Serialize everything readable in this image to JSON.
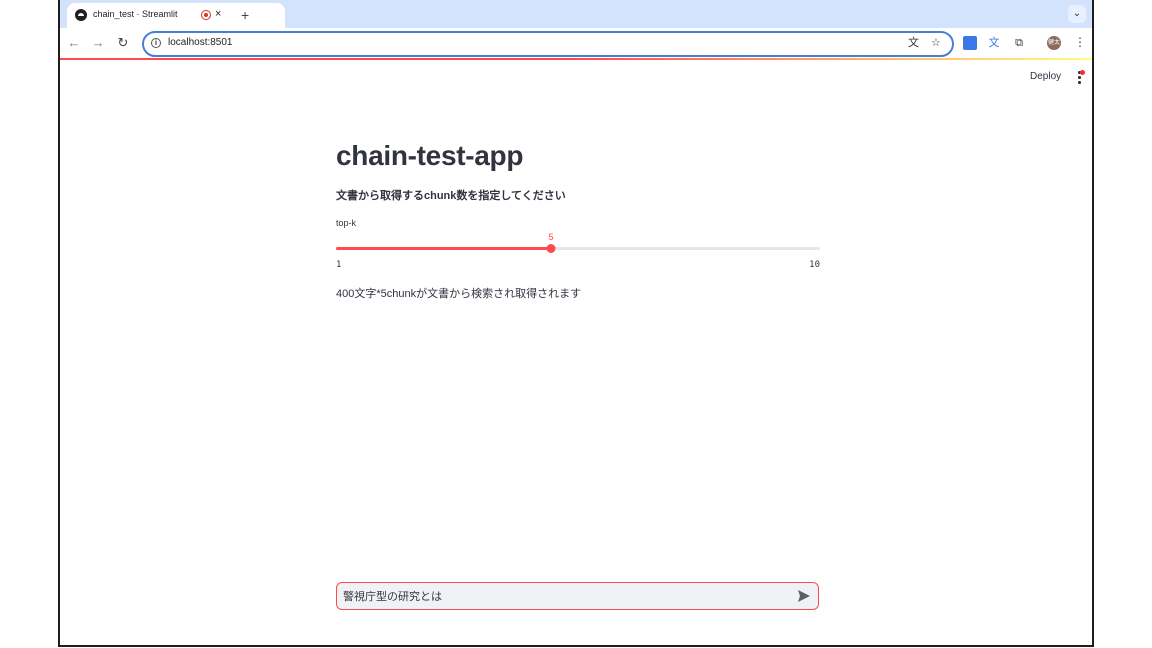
{
  "browser": {
    "tab_title": "chain_test · Streamlit",
    "tab_close": "×",
    "new_tab": "+",
    "url": "localhost:8501",
    "avatar_initials": "健太"
  },
  "app": {
    "deploy_label": "Deploy",
    "title": "chain-test-app",
    "subtitle": "文書から取得するchunk数を指定してください",
    "slider": {
      "label": "top-k",
      "min": 1,
      "max": 10,
      "value": 5
    },
    "result_text": "400文字*5chunkが文書から検索され取得されます",
    "chat": {
      "value": "警視庁型の研究とは"
    }
  },
  "colors": {
    "accent": "#ff4b4b",
    "text": "#31333f",
    "chat_bg": "#f0f2f6",
    "omnibox_border": "#4a7fd9"
  }
}
